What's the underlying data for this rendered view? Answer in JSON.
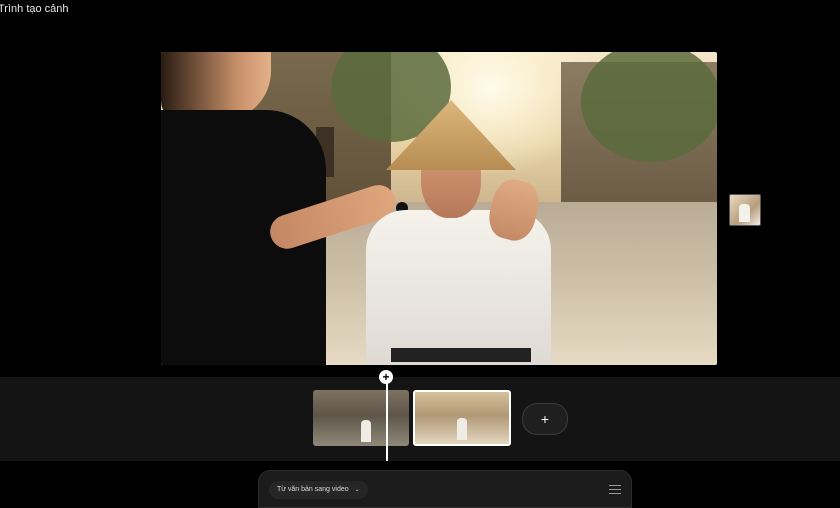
{
  "app": {
    "title": "Trình tạo cảnh"
  },
  "timeline": {
    "add_label": "+",
    "playhead_label": "+"
  },
  "prompt_bar": {
    "mode_label": "Từ văn bản sang video",
    "mode_chevron": "⌄"
  },
  "icons": {
    "add": "plus-icon",
    "playhead": "plus-icon",
    "settings": "sliders-icon",
    "chevron": "chevron-down-icon"
  },
  "colors": {
    "background": "#000000",
    "timeline": "#141414",
    "selected_border": "#ffffff"
  }
}
